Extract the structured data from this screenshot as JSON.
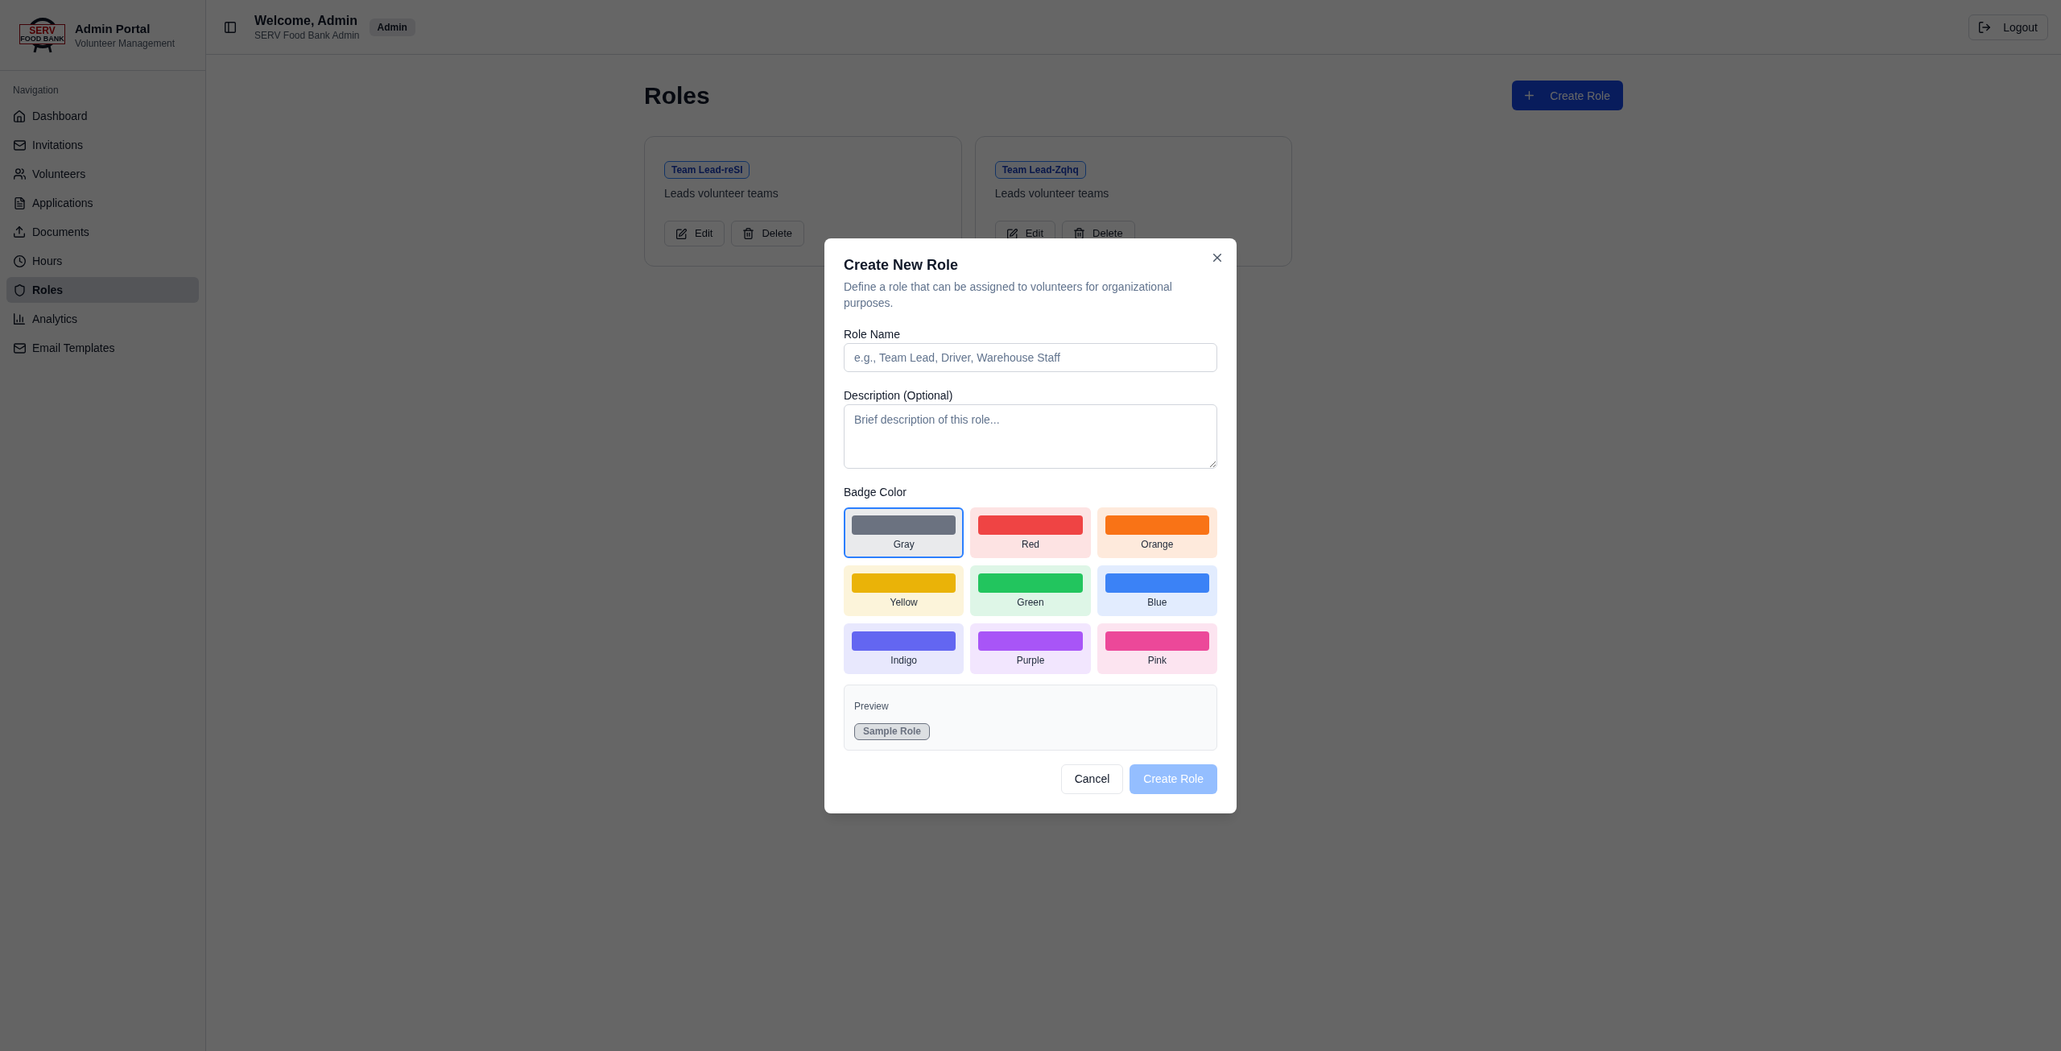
{
  "sidebar": {
    "logo": {
      "title": "SERV",
      "subtitle": "FOOD BANK"
    },
    "app_title": "Admin Portal",
    "app_subtitle": "Volunteer Management",
    "section_label": "Navigation",
    "items": [
      {
        "label": "Dashboard",
        "selected": false
      },
      {
        "label": "Invitations",
        "selected": false
      },
      {
        "label": "Volunteers",
        "selected": false
      },
      {
        "label": "Applications",
        "selected": false
      },
      {
        "label": "Documents",
        "selected": false
      },
      {
        "label": "Hours",
        "selected": false
      },
      {
        "label": "Roles",
        "selected": true
      },
      {
        "label": "Analytics",
        "selected": false
      },
      {
        "label": "Email Templates",
        "selected": false
      }
    ]
  },
  "header": {
    "welcome": "Welcome, Admin",
    "organization": "SERV Food Bank Admin",
    "role_badge": "Admin",
    "logout": "Logout"
  },
  "page": {
    "title": "Roles",
    "create_button": "Create Role",
    "roles": [
      {
        "name": "Team Lead-reSI",
        "description": "Leads volunteer teams",
        "actions": [
          {
            "kind": "edit",
            "label": "Edit"
          },
          {
            "kind": "delete",
            "label": "Delete"
          }
        ]
      },
      {
        "name": "Team Lead-Zqhq",
        "description": "Leads volunteer teams",
        "actions": [
          {
            "kind": "edit",
            "label": "Edit"
          },
          {
            "kind": "delete",
            "label": "Delete"
          }
        ]
      }
    ]
  },
  "dialog": {
    "title": "Create New Role",
    "description": "Define a role that can be assigned to volunteers for organizational purposes.",
    "fields": [
      {
        "kind": "input",
        "label": "Role Name",
        "placeholder": "e.g., Team Lead, Driver, Warehouse Staff"
      },
      {
        "kind": "textarea",
        "label": "Description (Optional)",
        "placeholder": "Brief description of this role..."
      }
    ],
    "color_label": "Badge Color",
    "colors": [
      {
        "label": "Gray",
        "color": "#6b7280",
        "selected": true
      },
      {
        "label": "Red",
        "color": "#ef4444",
        "selected": false
      },
      {
        "label": "Orange",
        "color": "#f97316",
        "selected": false
      },
      {
        "label": "Yellow",
        "color": "#eab308",
        "selected": false
      },
      {
        "label": "Green",
        "color": "#22c55e",
        "selected": false
      },
      {
        "label": "Blue",
        "color": "#3b82f6",
        "selected": false
      },
      {
        "label": "Indigo",
        "color": "#6366f1",
        "selected": false
      },
      {
        "label": "Purple",
        "color": "#a855f7",
        "selected": false
      },
      {
        "label": "Pink",
        "color": "#ec4899",
        "selected": false
      }
    ],
    "preview": {
      "label": "Preview",
      "sample": "Sample Role"
    },
    "buttons": [
      {
        "kind": "secondary",
        "label": "Cancel",
        "disabled": false
      },
      {
        "kind": "primary",
        "label": "Create Role",
        "disabled": true
      }
    ]
  }
}
